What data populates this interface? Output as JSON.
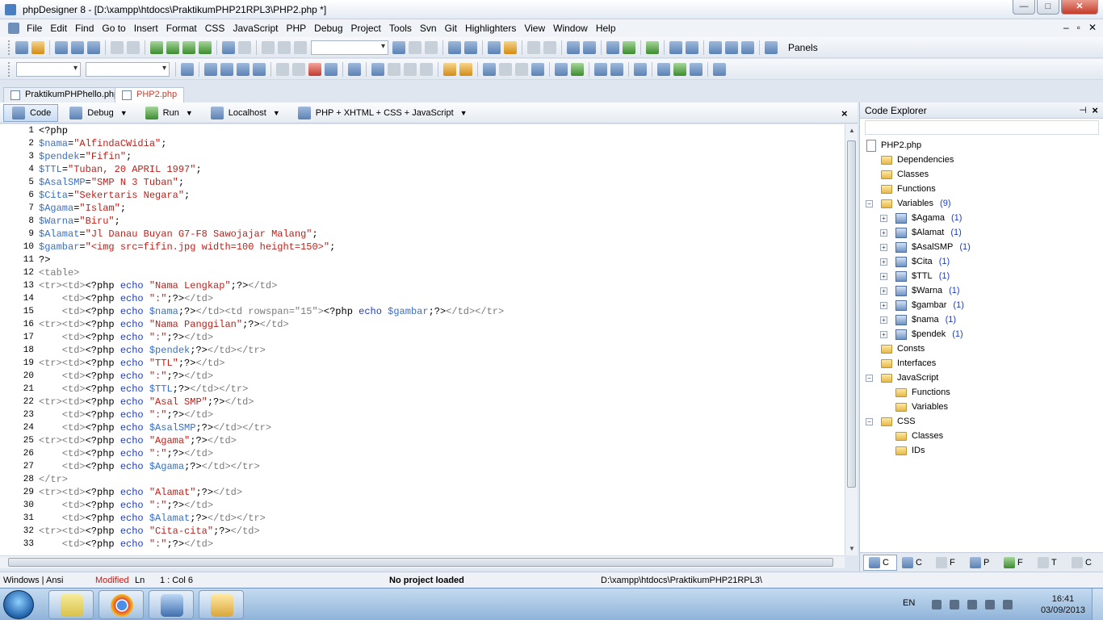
{
  "window": {
    "title": "phpDesigner 8 - [D:\\xampp\\htdocs\\PraktikumPHP21RPL3\\PHP2.php *]",
    "minimize": "—",
    "maximize": "□",
    "close": "✕"
  },
  "menu": {
    "items": [
      "File",
      "Edit",
      "Find",
      "Go to",
      "Insert",
      "Format",
      "CSS",
      "JavaScript",
      "PHP",
      "Debug",
      "Project",
      "Tools",
      "Svn",
      "Git",
      "Highlighters",
      "View",
      "Window",
      "Help"
    ],
    "doc_buttons": [
      "–",
      "▫",
      "✕"
    ]
  },
  "toolbar": {
    "panels_label": "Panels"
  },
  "tabs": [
    {
      "label": "PraktikumPHPhello.php"
    },
    {
      "label": "PHP2.php"
    }
  ],
  "subbar": {
    "code_label": "Code",
    "debug_label": "Debug",
    "run_label": "Run",
    "localhost_label": "Localhost",
    "highlighter_label": "PHP + XHTML + CSS + JavaScript",
    "close": "×"
  },
  "editor": {
    "lines": [
      {
        "n": "1",
        "segs": [
          {
            "t": "<?php",
            "c": "#000000"
          }
        ]
      },
      {
        "n": "2",
        "segs": [
          {
            "t": "$nama",
            "c": "#3a6fc4"
          },
          {
            "t": "=",
            "c": "#000000"
          },
          {
            "t": "\"AlfindaCWidia\"",
            "c": "#c0201a"
          },
          {
            "t": ";",
            "c": "#000000"
          }
        ]
      },
      {
        "n": "3",
        "segs": [
          {
            "t": "$pendek",
            "c": "#3a6fc4"
          },
          {
            "t": "=",
            "c": "#000000"
          },
          {
            "t": "\"Fifin\"",
            "c": "#c0201a"
          },
          {
            "t": ";",
            "c": "#000000"
          }
        ]
      },
      {
        "n": "4",
        "segs": [
          {
            "t": "$TTL",
            "c": "#3a6fc4"
          },
          {
            "t": "=",
            "c": "#000000"
          },
          {
            "t": "\"Tuban, 20 APRIL 1997\"",
            "c": "#c0201a"
          },
          {
            "t": ";",
            "c": "#000000"
          }
        ]
      },
      {
        "n": "5",
        "segs": [
          {
            "t": "$AsalSMP",
            "c": "#3a6fc4"
          },
          {
            "t": "=",
            "c": "#000000"
          },
          {
            "t": "\"SMP N 3 Tuban\"",
            "c": "#c0201a"
          },
          {
            "t": ";",
            "c": "#000000"
          }
        ]
      },
      {
        "n": "6",
        "segs": [
          {
            "t": "$Cita",
            "c": "#3a6fc4"
          },
          {
            "t": "=",
            "c": "#000000"
          },
          {
            "t": "\"Sekertaris Negara\"",
            "c": "#c0201a"
          },
          {
            "t": ";",
            "c": "#000000"
          }
        ]
      },
      {
        "n": "7",
        "segs": [
          {
            "t": "$Agama",
            "c": "#3a6fc4"
          },
          {
            "t": "=",
            "c": "#000000"
          },
          {
            "t": "\"Islam\"",
            "c": "#c0201a"
          },
          {
            "t": ";",
            "c": "#000000"
          }
        ]
      },
      {
        "n": "8",
        "segs": [
          {
            "t": "$Warna",
            "c": "#3a6fc4"
          },
          {
            "t": "=",
            "c": "#000000"
          },
          {
            "t": "\"Biru\"",
            "c": "#c0201a"
          },
          {
            "t": ";",
            "c": "#000000"
          }
        ]
      },
      {
        "n": "9",
        "segs": [
          {
            "t": "$Alamat",
            "c": "#3a6fc4"
          },
          {
            "t": "=",
            "c": "#000000"
          },
          {
            "t": "\"Jl Danau Buyan G7-F8 Sawojajar Malang\"",
            "c": "#c0201a"
          },
          {
            "t": ";",
            "c": "#000000"
          }
        ]
      },
      {
        "n": "10",
        "segs": [
          {
            "t": "$gambar",
            "c": "#3a6fc4"
          },
          {
            "t": "=",
            "c": "#000000"
          },
          {
            "t": "\"<img src=fifin.jpg width=100 height=150>\"",
            "c": "#c0201a"
          },
          {
            "t": ";",
            "c": "#000000"
          }
        ]
      },
      {
        "n": "11",
        "segs": [
          {
            "t": "?>",
            "c": "#000000"
          }
        ]
      },
      {
        "n": "12",
        "segs": [
          {
            "t": "<table>",
            "c": "#7a7a7a"
          }
        ]
      },
      {
        "n": "13",
        "segs": [
          {
            "t": "<tr><td>",
            "c": "#7a7a7a"
          },
          {
            "t": "<?php ",
            "c": "#000000"
          },
          {
            "t": "echo ",
            "c": "#1a3ccf"
          },
          {
            "t": "\"Nama Lengkap\"",
            "c": "#c0201a"
          },
          {
            "t": ";?>",
            "c": "#000000"
          },
          {
            "t": "</td>",
            "c": "#7a7a7a"
          }
        ]
      },
      {
        "n": "14",
        "segs": [
          {
            "t": "    <td>",
            "c": "#7a7a7a"
          },
          {
            "t": "<?php ",
            "c": "#000000"
          },
          {
            "t": "echo ",
            "c": "#1a3ccf"
          },
          {
            "t": "\":\"",
            "c": "#c0201a"
          },
          {
            "t": ";?>",
            "c": "#000000"
          },
          {
            "t": "</td>",
            "c": "#7a7a7a"
          }
        ]
      },
      {
        "n": "15",
        "segs": [
          {
            "t": "    <td>",
            "c": "#7a7a7a"
          },
          {
            "t": "<?php ",
            "c": "#000000"
          },
          {
            "t": "echo ",
            "c": "#1a3ccf"
          },
          {
            "t": "$nama",
            "c": "#3a6fc4"
          },
          {
            "t": ";?>",
            "c": "#000000"
          },
          {
            "t": "</td><td rowspan=\"15\">",
            "c": "#7a7a7a"
          },
          {
            "t": "<?php ",
            "c": "#000000"
          },
          {
            "t": "echo ",
            "c": "#1a3ccf"
          },
          {
            "t": "$gambar",
            "c": "#3a6fc4"
          },
          {
            "t": ";?>",
            "c": "#000000"
          },
          {
            "t": "</td></tr>",
            "c": "#7a7a7a"
          }
        ]
      },
      {
        "n": "16",
        "segs": [
          {
            "t": "<tr><td>",
            "c": "#7a7a7a"
          },
          {
            "t": "<?php ",
            "c": "#000000"
          },
          {
            "t": "echo ",
            "c": "#1a3ccf"
          },
          {
            "t": "\"Nama Panggilan\"",
            "c": "#c0201a"
          },
          {
            "t": ";?>",
            "c": "#000000"
          },
          {
            "t": "</td>",
            "c": "#7a7a7a"
          }
        ]
      },
      {
        "n": "17",
        "segs": [
          {
            "t": "    <td>",
            "c": "#7a7a7a"
          },
          {
            "t": "<?php ",
            "c": "#000000"
          },
          {
            "t": "echo ",
            "c": "#1a3ccf"
          },
          {
            "t": "\":\"",
            "c": "#c0201a"
          },
          {
            "t": ";?>",
            "c": "#000000"
          },
          {
            "t": "</td>",
            "c": "#7a7a7a"
          }
        ]
      },
      {
        "n": "18",
        "segs": [
          {
            "t": "    <td>",
            "c": "#7a7a7a"
          },
          {
            "t": "<?php ",
            "c": "#000000"
          },
          {
            "t": "echo ",
            "c": "#1a3ccf"
          },
          {
            "t": "$pendek",
            "c": "#3a6fc4"
          },
          {
            "t": ";?>",
            "c": "#000000"
          },
          {
            "t": "</td></tr>",
            "c": "#7a7a7a"
          }
        ]
      },
      {
        "n": "19",
        "segs": [
          {
            "t": "<tr><td>",
            "c": "#7a7a7a"
          },
          {
            "t": "<?php ",
            "c": "#000000"
          },
          {
            "t": "echo ",
            "c": "#1a3ccf"
          },
          {
            "t": "\"TTL\"",
            "c": "#c0201a"
          },
          {
            "t": ";?>",
            "c": "#000000"
          },
          {
            "t": "</td>",
            "c": "#7a7a7a"
          }
        ]
      },
      {
        "n": "20",
        "segs": [
          {
            "t": "    <td>",
            "c": "#7a7a7a"
          },
          {
            "t": "<?php ",
            "c": "#000000"
          },
          {
            "t": "echo ",
            "c": "#1a3ccf"
          },
          {
            "t": "\":\"",
            "c": "#c0201a"
          },
          {
            "t": ";?>",
            "c": "#000000"
          },
          {
            "t": "</td>",
            "c": "#7a7a7a"
          }
        ]
      },
      {
        "n": "21",
        "segs": [
          {
            "t": "    <td>",
            "c": "#7a7a7a"
          },
          {
            "t": "<?php ",
            "c": "#000000"
          },
          {
            "t": "echo ",
            "c": "#1a3ccf"
          },
          {
            "t": "$TTL",
            "c": "#3a6fc4"
          },
          {
            "t": ";?>",
            "c": "#000000"
          },
          {
            "t": "</td></tr>",
            "c": "#7a7a7a"
          }
        ]
      },
      {
        "n": "22",
        "segs": [
          {
            "t": "<tr><td>",
            "c": "#7a7a7a"
          },
          {
            "t": "<?php ",
            "c": "#000000"
          },
          {
            "t": "echo ",
            "c": "#1a3ccf"
          },
          {
            "t": "\"Asal SMP\"",
            "c": "#c0201a"
          },
          {
            "t": ";?>",
            "c": "#000000"
          },
          {
            "t": "</td>",
            "c": "#7a7a7a"
          }
        ]
      },
      {
        "n": "23",
        "segs": [
          {
            "t": "    <td>",
            "c": "#7a7a7a"
          },
          {
            "t": "<?php ",
            "c": "#000000"
          },
          {
            "t": "echo ",
            "c": "#1a3ccf"
          },
          {
            "t": "\":\"",
            "c": "#c0201a"
          },
          {
            "t": ";?>",
            "c": "#000000"
          },
          {
            "t": "</td>",
            "c": "#7a7a7a"
          }
        ]
      },
      {
        "n": "24",
        "segs": [
          {
            "t": "    <td>",
            "c": "#7a7a7a"
          },
          {
            "t": "<?php ",
            "c": "#000000"
          },
          {
            "t": "echo ",
            "c": "#1a3ccf"
          },
          {
            "t": "$AsalSMP",
            "c": "#3a6fc4"
          },
          {
            "t": ";?>",
            "c": "#000000"
          },
          {
            "t": "</td></tr>",
            "c": "#7a7a7a"
          }
        ]
      },
      {
        "n": "25",
        "segs": [
          {
            "t": "<tr><td>",
            "c": "#7a7a7a"
          },
          {
            "t": "<?php ",
            "c": "#000000"
          },
          {
            "t": "echo ",
            "c": "#1a3ccf"
          },
          {
            "t": "\"Agama\"",
            "c": "#c0201a"
          },
          {
            "t": ";?>",
            "c": "#000000"
          },
          {
            "t": "</td>",
            "c": "#7a7a7a"
          }
        ]
      },
      {
        "n": "26",
        "segs": [
          {
            "t": "    <td>",
            "c": "#7a7a7a"
          },
          {
            "t": "<?php ",
            "c": "#000000"
          },
          {
            "t": "echo ",
            "c": "#1a3ccf"
          },
          {
            "t": "\":\"",
            "c": "#c0201a"
          },
          {
            "t": ";?>",
            "c": "#000000"
          },
          {
            "t": "</td>",
            "c": "#7a7a7a"
          }
        ]
      },
      {
        "n": "27",
        "segs": [
          {
            "t": "    <td>",
            "c": "#7a7a7a"
          },
          {
            "t": "<?php ",
            "c": "#000000"
          },
          {
            "t": "echo ",
            "c": "#1a3ccf"
          },
          {
            "t": "$Agama",
            "c": "#3a6fc4"
          },
          {
            "t": ";?>",
            "c": "#000000"
          },
          {
            "t": "</td></tr>",
            "c": "#7a7a7a"
          }
        ]
      },
      {
        "n": "28",
        "segs": [
          {
            "t": "</tr>",
            "c": "#7a7a7a"
          }
        ]
      },
      {
        "n": "29",
        "segs": [
          {
            "t": "<tr><td>",
            "c": "#7a7a7a"
          },
          {
            "t": "<?php ",
            "c": "#000000"
          },
          {
            "t": "echo ",
            "c": "#1a3ccf"
          },
          {
            "t": "\"Alamat\"",
            "c": "#c0201a"
          },
          {
            "t": ";?>",
            "c": "#000000"
          },
          {
            "t": "</td>",
            "c": "#7a7a7a"
          }
        ]
      },
      {
        "n": "30",
        "segs": [
          {
            "t": "    <td>",
            "c": "#7a7a7a"
          },
          {
            "t": "<?php ",
            "c": "#000000"
          },
          {
            "t": "echo ",
            "c": "#1a3ccf"
          },
          {
            "t": "\":\"",
            "c": "#c0201a"
          },
          {
            "t": ";?>",
            "c": "#000000"
          },
          {
            "t": "</td>",
            "c": "#7a7a7a"
          }
        ]
      },
      {
        "n": "31",
        "segs": [
          {
            "t": "    <td>",
            "c": "#7a7a7a"
          },
          {
            "t": "<?php ",
            "c": "#000000"
          },
          {
            "t": "echo ",
            "c": "#1a3ccf"
          },
          {
            "t": "$Alamat",
            "c": "#3a6fc4"
          },
          {
            "t": ";?>",
            "c": "#000000"
          },
          {
            "t": "</td></tr>",
            "c": "#7a7a7a"
          }
        ]
      },
      {
        "n": "32",
        "segs": [
          {
            "t": "<tr><td>",
            "c": "#7a7a7a"
          },
          {
            "t": "<?php ",
            "c": "#000000"
          },
          {
            "t": "echo ",
            "c": "#1a3ccf"
          },
          {
            "t": "\"Cita-cita\"",
            "c": "#c0201a"
          },
          {
            "t": ";?>",
            "c": "#000000"
          },
          {
            "t": "</td>",
            "c": "#7a7a7a"
          }
        ]
      },
      {
        "n": "33",
        "segs": [
          {
            "t": "    <td>",
            "c": "#7a7a7a"
          },
          {
            "t": "<?php ",
            "c": "#000000"
          },
          {
            "t": "echo ",
            "c": "#1a3ccf"
          },
          {
            "t": "\":\"",
            "c": "#c0201a"
          },
          {
            "t": ";?>",
            "c": "#000000"
          },
          {
            "t": "</td>",
            "c": "#7a7a7a"
          }
        ]
      }
    ]
  },
  "explorer": {
    "title": "Code Explorer",
    "pin": "⊣",
    "close": "×",
    "tree": [
      {
        "label": "PHP2.php",
        "icon": "file",
        "exp": ""
      },
      {
        "label": "Dependencies",
        "icon": "folder",
        "exp": ""
      },
      {
        "label": "Classes",
        "icon": "folder",
        "exp": ""
      },
      {
        "label": "Functions",
        "icon": "folder",
        "exp": ""
      },
      {
        "label": "Variables",
        "icon": "folder",
        "exp": "−",
        "count": "(9)"
      },
      {
        "label": "$Agama",
        "icon": "var",
        "exp": "+",
        "count": "(1)"
      },
      {
        "label": "$Alamat",
        "icon": "var",
        "exp": "+",
        "count": "(1)"
      },
      {
        "label": "$AsalSMP",
        "icon": "var",
        "exp": "+",
        "count": "(1)"
      },
      {
        "label": "$Cita",
        "icon": "var",
        "exp": "+",
        "count": "(1)"
      },
      {
        "label": "$TTL",
        "icon": "var",
        "exp": "+",
        "count": "(1)"
      },
      {
        "label": "$Warna",
        "icon": "var",
        "exp": "+",
        "count": "(1)"
      },
      {
        "label": "$gambar",
        "icon": "var",
        "exp": "+",
        "count": "(1)"
      },
      {
        "label": "$nama",
        "icon": "var",
        "exp": "+",
        "count": "(1)"
      },
      {
        "label": "$pendek",
        "icon": "var",
        "exp": "+",
        "count": "(1)"
      },
      {
        "label": "Consts",
        "icon": "folder",
        "exp": ""
      },
      {
        "label": "Interfaces",
        "icon": "folder",
        "exp": ""
      },
      {
        "label": "JavaScript",
        "icon": "folder",
        "exp": "−"
      },
      {
        "label": "Functions",
        "icon": "folder",
        "exp": ""
      },
      {
        "label": "Variables",
        "icon": "folder",
        "exp": ""
      },
      {
        "label": "CSS",
        "icon": "folder",
        "exp": "−"
      },
      {
        "label": "Classes",
        "icon": "folder",
        "exp": ""
      },
      {
        "label": "IDs",
        "icon": "folder",
        "exp": ""
      }
    ],
    "bottom_tabs": [
      "C",
      "C",
      "F",
      "P",
      "F",
      "T",
      "C"
    ]
  },
  "status": {
    "encoding": "Windows | Ansi",
    "modified": "Modified",
    "ln_label": "Ln",
    "position": "1 : Col  6",
    "project": "No project loaded",
    "path": "D:\\xampp\\htdocs\\PraktikumPHP21RPL3\\"
  },
  "taskbar": {
    "lang": "EN",
    "time": "16:41",
    "date": "03/09/2013"
  }
}
